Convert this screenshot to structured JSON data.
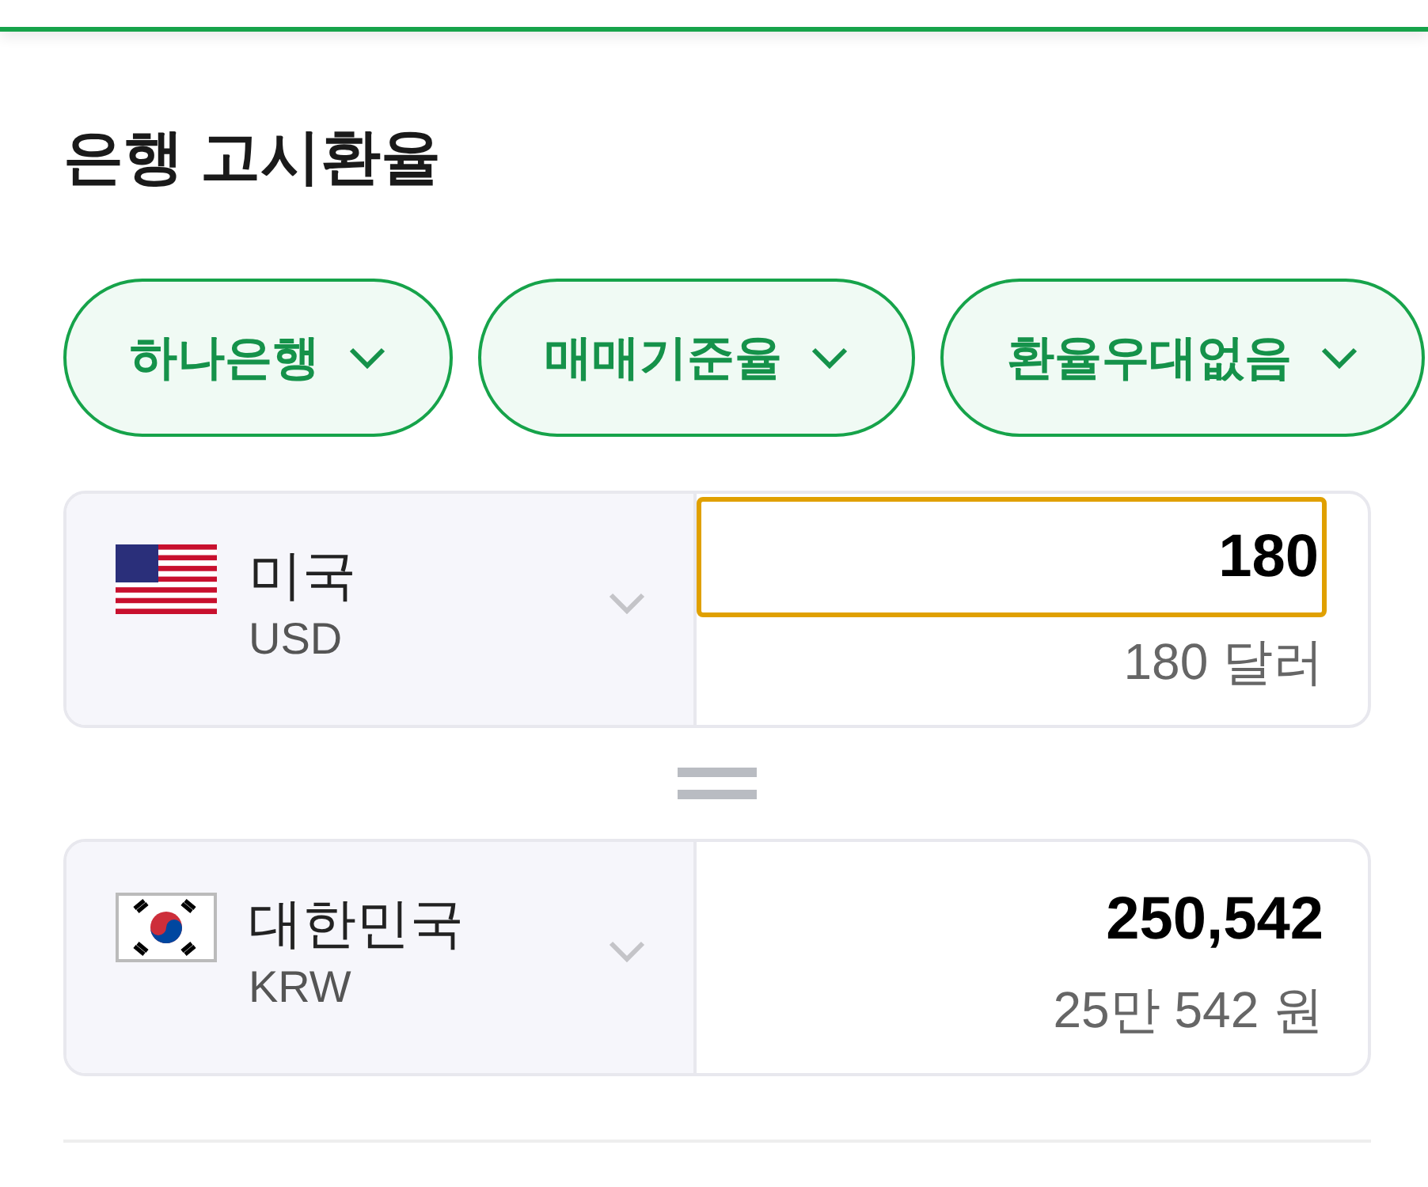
{
  "title": "은행 고시환율",
  "filters": [
    {
      "label": "하나은행"
    },
    {
      "label": "매매기준율"
    },
    {
      "label": "환율우대없음"
    }
  ],
  "converters": [
    {
      "kind": "us",
      "country": "미국",
      "code": "USD",
      "amount": "180",
      "amount_words": "180 달러",
      "focused": true
    },
    {
      "kind": "kr",
      "country": "대한민국",
      "code": "KRW",
      "amount": "250,542",
      "amount_words": "25만 542 원",
      "focused": false
    }
  ]
}
